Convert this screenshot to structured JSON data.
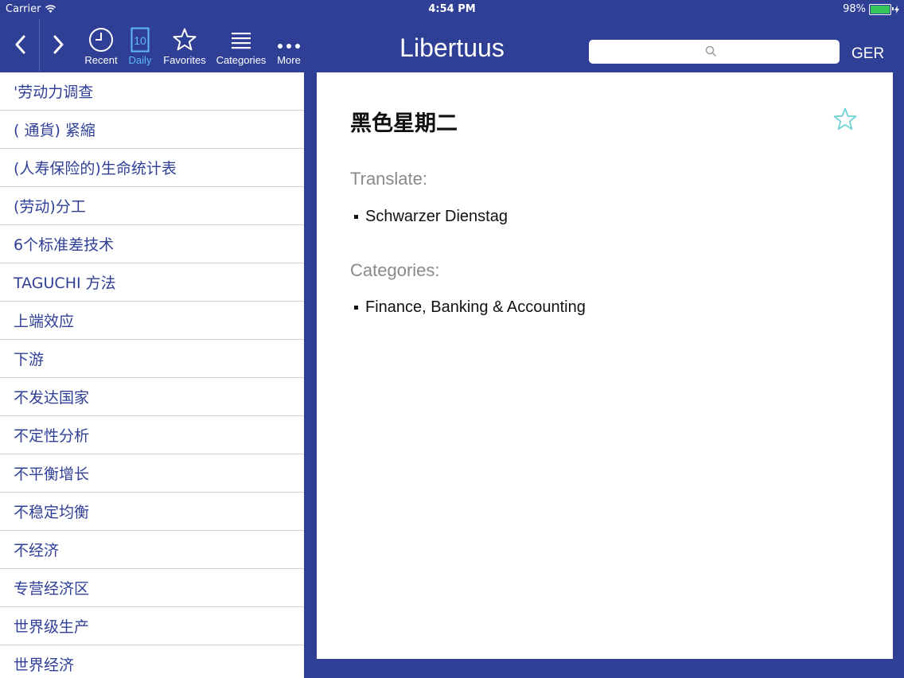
{
  "status_bar": {
    "carrier": "Carrier",
    "time": "4:54 PM",
    "battery": "98%",
    "battery_level": 0.98
  },
  "toolbar": {
    "tools": [
      {
        "label": "Recent",
        "icon": "clock-icon"
      },
      {
        "label": "Daily",
        "icon": "calendar-day-icon",
        "day": "10",
        "active": true
      },
      {
        "label": "Favorites",
        "icon": "star-icon"
      },
      {
        "label": "Categories",
        "icon": "list-icon"
      },
      {
        "label": "More",
        "icon": "more-dots-icon"
      }
    ],
    "app_title": "Libertuus",
    "search_placeholder": "",
    "language": "GER"
  },
  "word_list": [
    "'劳动力调查",
    "( 通貨) 紧縮",
    "(人寿保险的)生命统计表",
    "(劳动)分工",
    "6个标准差技术",
    "TAGUCHI 方法",
    "上端效应",
    "下游",
    "不发达国家",
    "不定性分析",
    "不平衡增长",
    "不稳定均衡",
    "不经济",
    "专营经济区",
    "世界级生产",
    "世界经济"
  ],
  "detail": {
    "word": "黑色星期二",
    "translate_heading": "Translate:",
    "translations": [
      "Schwarzer Dienstag"
    ],
    "categories_heading": "Categories:",
    "categories": [
      "Finance, Banking & Accounting"
    ]
  },
  "colors": {
    "bar": "#2f3f96",
    "active_tab": "#5fb8ff",
    "star_outline": "#6fd3d6"
  }
}
